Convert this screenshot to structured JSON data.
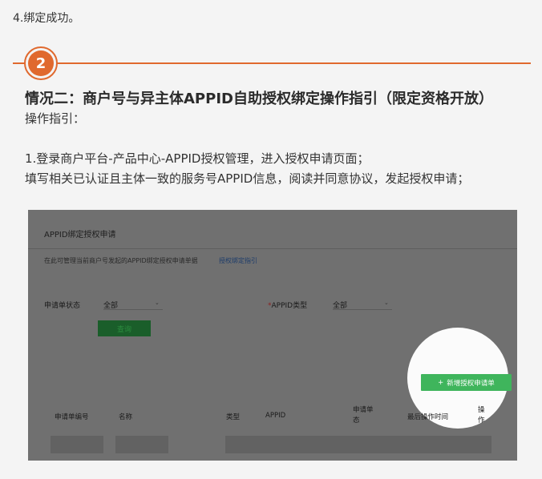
{
  "top_line": "4.绑定成功。",
  "section": {
    "badge_number": "2",
    "heading": "情况二：商户号与异主体APPID自助授权绑定操作指引（限定资格开放）",
    "subheading": "操作指引：",
    "step1_line1": "1.登录商户平台-产品中心-APPID授权管理，进入授权申请页面；",
    "step1_line2": "填写相关已认证且主体一致的服务号APPID信息，阅读并同意协议，发起授权申请；"
  },
  "screenshot": {
    "title": "APPID绑定授权申请",
    "description": "在此可管理当前商户号发起的APPID绑定授权申请单据",
    "guide_link": "授权绑定指引",
    "filter_status_label": "申请单状态",
    "filter_status_value": "全部",
    "filter_type_label": "APPID类型",
    "filter_type_required": "*",
    "filter_type_value": "全部",
    "query_button": "查询",
    "add_button": "新增授权申请单",
    "add_button_icon": "plus-icon",
    "table_headers": {
      "number": "申请单编号",
      "name": "名称",
      "type": "类型",
      "appid": "APPID",
      "status_line1": "申请单",
      "status_line2": "状",
      "status_line3": "态",
      "last_time": "最后操作时间",
      "action_line1": "操",
      "action_line2": "作"
    }
  },
  "colors": {
    "accent": "#e0692e",
    "green_button": "#3fb55c"
  }
}
